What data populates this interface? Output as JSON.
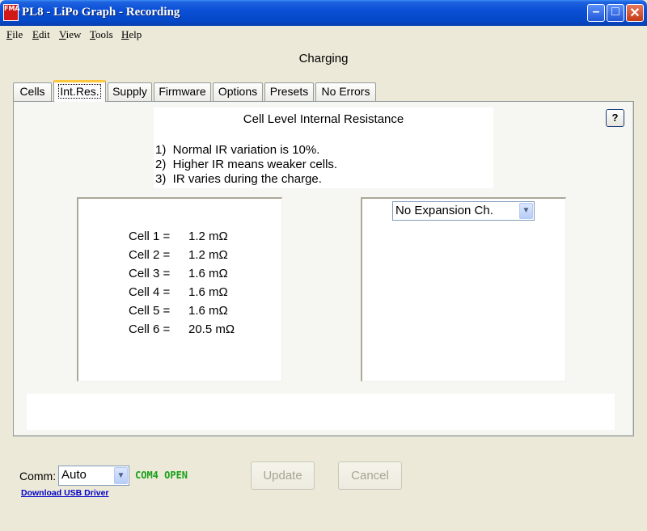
{
  "window": {
    "title": "PL8 - LiPo Graph - Recording",
    "icon_glyph": "FMA",
    "buttons": {
      "minimize": "–",
      "maximize": "□",
      "close": "✕"
    }
  },
  "menu": [
    {
      "first": "F",
      "rest": "ile"
    },
    {
      "first": "E",
      "rest": "dit"
    },
    {
      "first": "V",
      "rest": "iew"
    },
    {
      "first": "T",
      "rest": "ools"
    },
    {
      "first": "H",
      "rest": "elp"
    }
  ],
  "state_title": "Charging",
  "tabs": [
    "Cells",
    "Int.Res.",
    "Supply",
    "Firmware",
    "Options",
    "Presets",
    "No Errors"
  ],
  "active_tab": "Int.Res.",
  "panel": {
    "help_label": "?",
    "title": "Cell Level Internal Resistance",
    "notes": [
      "1)  Normal IR variation is 10%.",
      "2)  Higher IR means weaker cells.",
      "3)  IR varies during the charge."
    ],
    "cells": [
      {
        "label": "Cell 1 =",
        "value": "1.2 mΩ"
      },
      {
        "label": "Cell 2 =",
        "value": "1.2 mΩ"
      },
      {
        "label": "Cell 3 =",
        "value": "1.6 mΩ"
      },
      {
        "label": "Cell 4 =",
        "value": "1.6 mΩ"
      },
      {
        "label": "Cell 5 =",
        "value": "1.6 mΩ"
      },
      {
        "label": "Cell 6 =",
        "value": "20.5 mΩ"
      }
    ],
    "expansion_select": "No Expansion Ch."
  },
  "footer": {
    "comm_label": "Comm:",
    "comm_value": "Auto",
    "com_status": "COM4 OPEN",
    "com_status_color": "#18a018",
    "usb_link": "Download USB Driver",
    "update_label": "Update",
    "cancel_label": "Cancel"
  },
  "icons": [
    "app-icon",
    "minimize-icon",
    "maximize-icon",
    "close-icon",
    "help-icon",
    "chevron-down-icon"
  ],
  "colors": {
    "titlebar": "#0548c8",
    "window_bg": "#ece9d8",
    "active_tab_accent": "#ffc83c",
    "link": "#0000c8"
  }
}
